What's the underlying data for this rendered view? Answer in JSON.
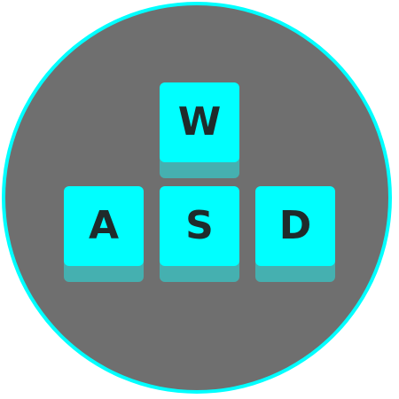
{
  "colors": {
    "background": "#6f6f6f",
    "ring": "#00ffff",
    "key_face": "#00ffff",
    "key_shadow": "#45b0b0",
    "letter": "#1f2b2b"
  },
  "keys": {
    "w": {
      "label": "W",
      "icon": "w-key-icon"
    },
    "a": {
      "label": "A",
      "icon": "a-key-icon"
    },
    "s": {
      "label": "S",
      "icon": "s-key-icon"
    },
    "d": {
      "label": "D",
      "icon": "d-key-icon"
    }
  }
}
